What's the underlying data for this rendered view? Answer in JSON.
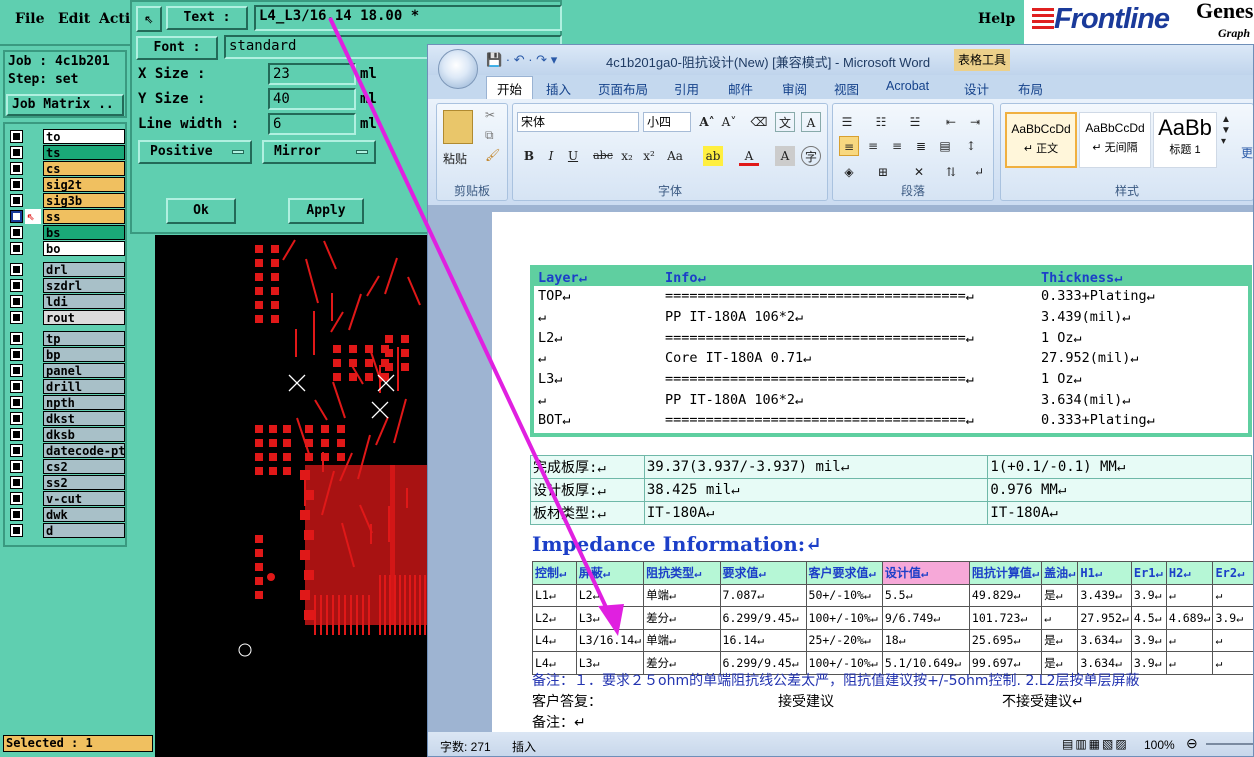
{
  "menubar": {
    "items": [
      "File",
      "Edit",
      "Acti"
    ],
    "help": "Help"
  },
  "logo": {
    "brand": "Frontline",
    "product": "Genes",
    "sub": "Graph"
  },
  "job": {
    "job_label": "Job : 4c1b201",
    "step_label": "Step: set",
    "matrix_button": "Job Matrix .."
  },
  "layers": [
    {
      "name": "to",
      "color": "#ffffff"
    },
    {
      "name": "ts",
      "color": "#1aa878"
    },
    {
      "name": "cs",
      "color": "#f0c060"
    },
    {
      "name": "sig2t",
      "color": "#f0c060"
    },
    {
      "name": "sig3b",
      "color": "#f0c060"
    },
    {
      "name": "ss",
      "color": "#f0c060"
    },
    {
      "name": "bs",
      "color": "#1aa878"
    },
    {
      "name": "bo",
      "color": "#ffffff"
    },
    {
      "name": "drl",
      "color": "#a8c0c8"
    },
    {
      "name": "szdrl",
      "color": "#a8c0c8"
    },
    {
      "name": "ldi",
      "color": "#a8c0c8"
    },
    {
      "name": "rout",
      "color": "#dcdcdc"
    },
    {
      "name": "tp",
      "color": "#a8c0c8"
    },
    {
      "name": "bp",
      "color": "#a8c0c8"
    },
    {
      "name": "panel",
      "color": "#a8c0c8"
    },
    {
      "name": "drill",
      "color": "#a8c0c8"
    },
    {
      "name": "npth",
      "color": "#a8c0c8"
    },
    {
      "name": "dkst",
      "color": "#a8c0c8"
    },
    {
      "name": "dksb",
      "color": "#a8c0c8"
    },
    {
      "name": "datecode-pt",
      "color": "#a8c0c8"
    },
    {
      "name": "cs2",
      "color": "#a8c0c8"
    },
    {
      "name": "ss2",
      "color": "#a8c0c8"
    },
    {
      "name": "v-cut",
      "color": "#a8c0c8"
    },
    {
      "name": "dwk",
      "color": "#a8c0c8"
    },
    {
      "name": "d",
      "color": "#a8c0c8"
    }
  ],
  "selected": "Selected : 1",
  "dialog": {
    "text_button": "Text :",
    "text_value": "L4_L3/16.14 18.00 *",
    "font_button": "Font :",
    "font_value": "standard",
    "xsize_label": "X Size      :",
    "xsize_value": "23",
    "xsize_unit": "ml",
    "ysize_label": "Y Size      :",
    "ysize_value": "40",
    "ysize_unit": "ml",
    "lw_label": "Line width  :",
    "lw_value": "6",
    "lw_unit": "ml",
    "polarity": "Positive",
    "mirror": "Mirror",
    "ok": "Ok",
    "apply": "Apply"
  },
  "word": {
    "title": "4c1b201ga0-阻抗设计(New) [兼容模式] - Microsoft Word",
    "table_tools": "表格工具",
    "tabs": [
      "开始",
      "插入",
      "页面布局",
      "引用",
      "邮件",
      "审阅",
      "视图",
      "Acrobat",
      "设计",
      "布局"
    ],
    "clipboard": {
      "paste": "粘贴",
      "label": "剪贴板"
    },
    "font": {
      "name": "宋体",
      "size": "小四",
      "label": "字体"
    },
    "paragraph_label": "段落",
    "styles": {
      "label": "样式",
      "items": [
        {
          "preview": "AaBbCcDd",
          "name": "↵ 正文"
        },
        {
          "preview": "AaBbCcDd",
          "name": "↵ 无间隔"
        },
        {
          "preview": "AaBb",
          "name": "标题 1"
        }
      ],
      "more": "更"
    },
    "status": {
      "words": "字数: 271",
      "insert": "插入",
      "zoom": "100%"
    }
  },
  "stack": {
    "header": [
      "Layer↵",
      "Info↵",
      "Thickness↵"
    ],
    "rows": [
      [
        "TOP↵",
        "=====================================↵",
        "0.333+Plating↵"
      ],
      [
        "↵",
        "PP     IT-180A    106*2↵",
        "3.439(mil)↵"
      ],
      [
        "L2↵",
        "=====================================↵",
        "1 Oz↵"
      ],
      [
        "↵",
        "Core     IT-180A    0.71↵",
        "27.952(mil)↵"
      ],
      [
        "L3↵",
        "=====================================↵",
        "1 Oz↵"
      ],
      [
        "↵",
        "PP     IT-180A    106*2↵",
        "3.634(mil)↵"
      ],
      [
        "BOT↵",
        "=====================================↵",
        "0.333+Plating↵"
      ]
    ]
  },
  "thickness": [
    [
      "完成板厚:↵",
      "39.37(3.937/-3.937) mil↵",
      "1(+0.1/-0.1) MM↵"
    ],
    [
      "设计板厚:↵",
      "38.425 mil↵",
      "0.976 MM↵"
    ],
    [
      "板材类型:↵",
      "IT-180A↵",
      "IT-180A↵"
    ]
  ],
  "impedance": {
    "title": "Impedance Information:↵",
    "header": [
      "控制↵",
      "屏蔽↵",
      "阻抗类型↵",
      "要求值↵",
      "客户要求值↵",
      "设计值↵",
      "阻抗计算值↵",
      "盖油↵",
      "H1↵",
      "Er1↵",
      "H2↵",
      "Er2↵"
    ],
    "rows": [
      [
        "L1↵",
        "L2↵",
        "单端↵",
        "7.087↵",
        "50+/-10%↵",
        "5.5↵",
        "49.829↵",
        "是↵",
        "3.439↵",
        "3.9↵",
        "↵",
        "↵"
      ],
      [
        "L2↵",
        "L3↵",
        "差分↵",
        "6.299/9.45↵",
        "100+/-10%↵",
        "9/6.749↵",
        "101.723↵",
        "↵",
        "27.952↵",
        "4.5↵",
        "4.689↵",
        "3.9↵"
      ],
      [
        "L4↵",
        "L3/16.14↵",
        "单端↵",
        "16.14↵",
        "25+/-20%↵",
        "18↵",
        "25.695↵",
        "是↵",
        "3.634↵",
        "3.9↵",
        "↵",
        "↵"
      ],
      [
        "L4↵",
        "L3↵",
        "差分↵",
        "6.299/9.45↵",
        "100+/-10%↵",
        "5.1/10.649↵",
        "99.697↵",
        "是↵",
        "3.634↵",
        "3.9↵",
        "↵",
        "↵"
      ]
    ]
  },
  "notes": {
    "remark": "备注：１．要求２５ohm的单端阻抗线公差太严，阻抗值建议按+/-5ohm控制. 2.L2层按单层屏蔽",
    "reply_label": "客户答复：",
    "accept": "接受建议",
    "reject": "不接受建议↵",
    "remark2": "备注：↵"
  },
  "colors": {
    "genesis_bg": "#5fcfb0",
    "copper": "#e01818",
    "arrow": "#e020e0",
    "header_green": "#5fcfa0"
  }
}
